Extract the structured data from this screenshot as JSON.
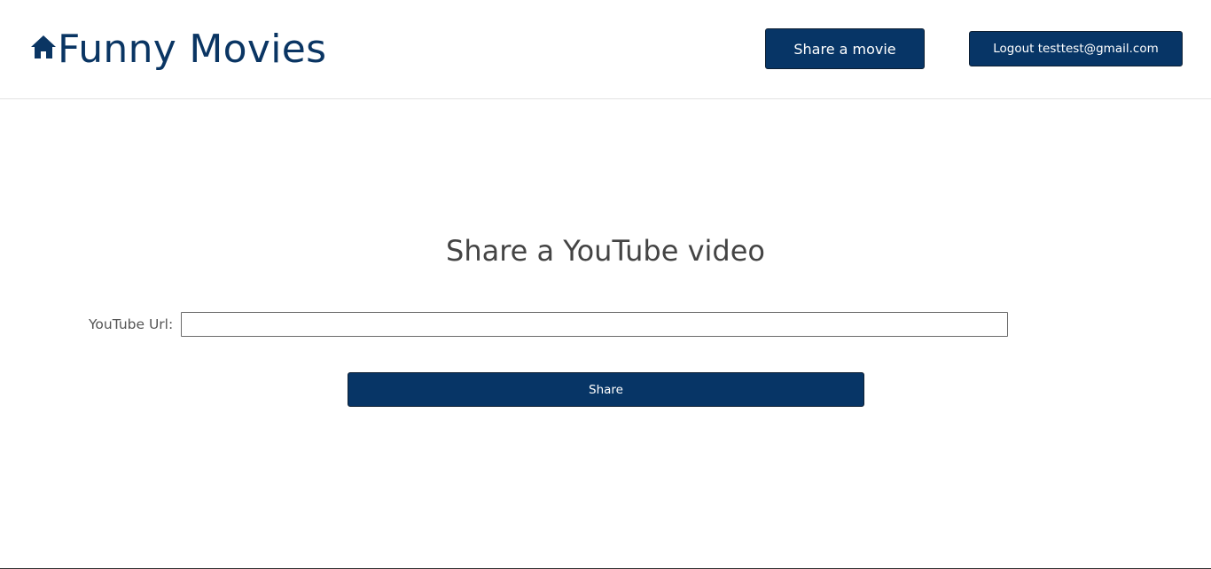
{
  "header": {
    "brand_title": "Funny Movies",
    "share_movie_label": "Share a movie",
    "logout_label": "Logout testtest@gmail.com"
  },
  "main": {
    "title": "Share a YouTube video",
    "url_label": "YouTube Url:",
    "url_value": "",
    "share_label": "Share"
  },
  "colors": {
    "brand": "#0a3563",
    "button_bg": "#073566",
    "text_muted": "#444444"
  },
  "icons": {
    "brand_icon": "home-icon"
  }
}
